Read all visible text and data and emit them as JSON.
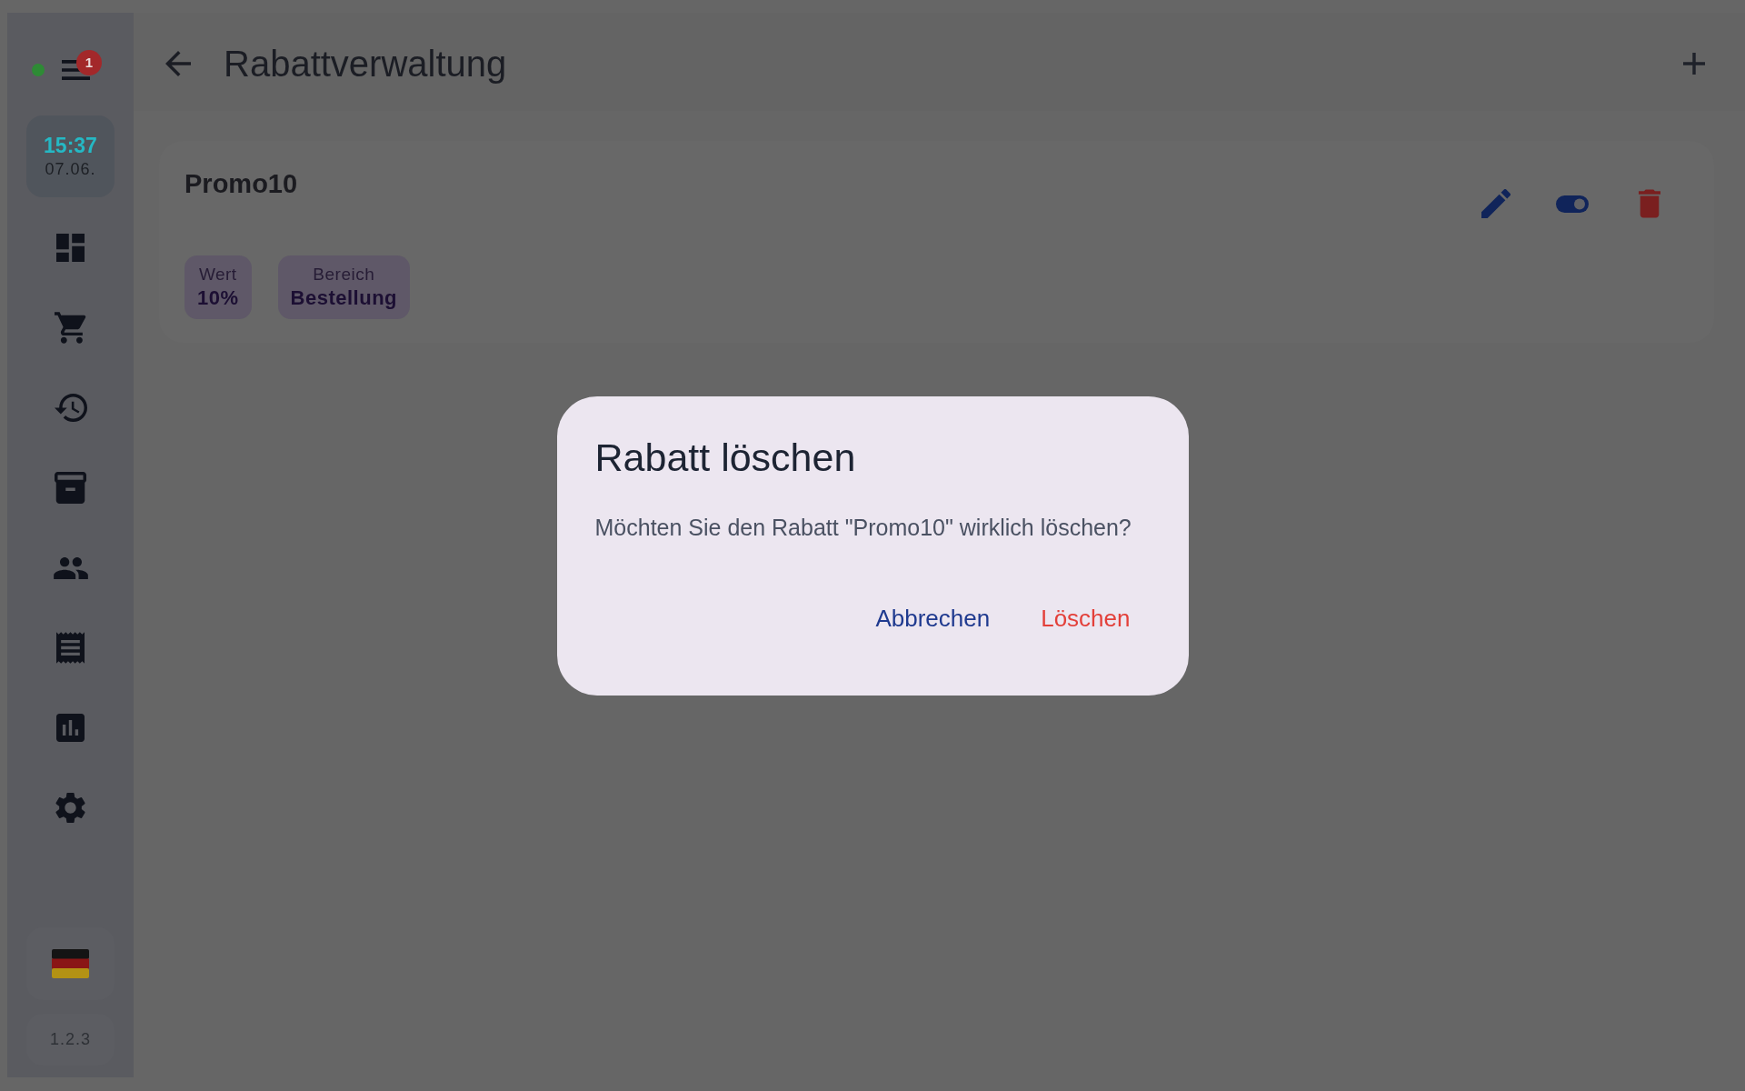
{
  "sidebar": {
    "connected": true,
    "menu_badge": "1",
    "clock": {
      "time": "15:37",
      "date": "07.06."
    },
    "version": "1.2.3"
  },
  "header": {
    "title": "Rabattverwaltung"
  },
  "discount": {
    "name": "Promo10",
    "active": true,
    "fields": [
      {
        "label": "Wert",
        "value": "10%"
      },
      {
        "label": "Bereich",
        "value": "Bestellung"
      }
    ]
  },
  "dialog": {
    "title": "Rabatt löschen",
    "message": "Möchten Sie den Rabatt \"Promo10\" wirklich löschen?",
    "buttons": [
      {
        "label": "Abbrechen",
        "kind": "cancel"
      },
      {
        "label": "Löschen",
        "kind": "destructive"
      }
    ]
  }
}
